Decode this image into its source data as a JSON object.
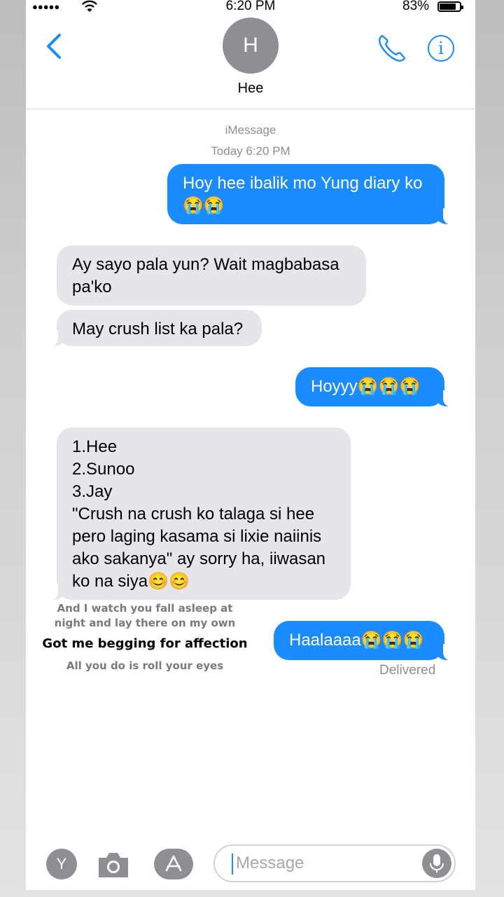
{
  "status": {
    "time": "6:20 PM",
    "battery": "83%",
    "battery_level": 0.83
  },
  "header": {
    "avatar_letter": "H",
    "contact_name": "Hee"
  },
  "thread": {
    "service": "iMessage",
    "timestamp": "Today 6:20 PM",
    "delivered": "Delivered"
  },
  "messages": [
    {
      "side": "sent",
      "text": "Hoy hee ibalik mo Yung diary ko 😭😭"
    },
    {
      "side": "received",
      "text": "Ay sayo pala yun? Wait magbabasa pa'ko"
    },
    {
      "side": "received",
      "text": "May crush list ka pala?"
    },
    {
      "side": "sent",
      "text": "Hoyyy😭😭😭"
    },
    {
      "side": "received",
      "lines": [
        "1.Hee",
        "2.Sunoo",
        "3.Jay",
        "\"Crush na crush ko talaga si hee",
        "pero laging kasama si lixie naiinis",
        "ako sakanya\" ay sorry ha, iiwasan",
        "ko na siya😊😊"
      ]
    },
    {
      "side": "sent",
      "text": "Haalaaaa😭😭😭"
    }
  ],
  "lyrics": {
    "line1": "And I watch you fall asleep at night and lay there on my own",
    "line2": "Got me begging for affection",
    "line3": "All you do is roll your eyes"
  },
  "compose": {
    "placeholder": "Message",
    "app_letter": "Y"
  },
  "icons": {
    "back": "chevron-left-icon",
    "call": "phone-icon",
    "details": "info-icon",
    "camera": "camera-icon",
    "apps": "app-store-icon",
    "mic": "microphone-icon"
  },
  "colors": {
    "sent": "#1a8cff",
    "received": "#e5e5ea",
    "accent": "#1a8cff"
  }
}
